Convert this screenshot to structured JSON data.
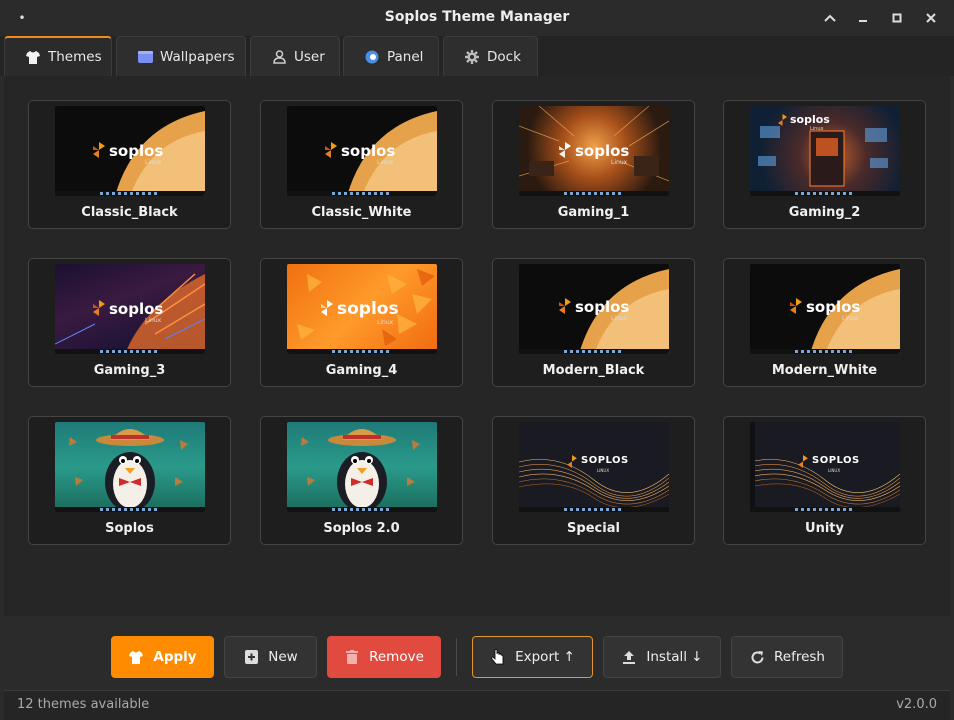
{
  "window": {
    "title": "Soplos Theme Manager",
    "menu_glyph": "•"
  },
  "tabs": [
    {
      "label": "Themes",
      "icon": "shirt-icon",
      "active": true
    },
    {
      "label": "Wallpapers",
      "icon": "wallpaper-icon",
      "active": false
    },
    {
      "label": "User",
      "icon": "user-icon",
      "active": false
    },
    {
      "label": "Panel",
      "icon": "panel-icon",
      "active": false
    },
    {
      "label": "Dock",
      "icon": "gear-icon",
      "active": false
    }
  ],
  "themes": [
    {
      "name": "Classic_Black",
      "logo": "soplos",
      "logo_sub": "Linux"
    },
    {
      "name": "Classic_White",
      "logo": "soplos",
      "logo_sub": "Linux"
    },
    {
      "name": "Gaming_1",
      "logo": "soplos",
      "logo_sub": "Linux"
    },
    {
      "name": "Gaming_2",
      "logo": "soplos",
      "logo_sub": "Linux"
    },
    {
      "name": "Gaming_3",
      "logo": "soplos",
      "logo_sub": "Linux"
    },
    {
      "name": "Gaming_4",
      "logo": "soplos",
      "logo_sub": "Linux"
    },
    {
      "name": "Modern_Black",
      "logo": "soplos",
      "logo_sub": "Linux"
    },
    {
      "name": "Modern_White",
      "logo": "soplos",
      "logo_sub": "Linux"
    },
    {
      "name": "Soplos",
      "logo": "",
      "logo_sub": ""
    },
    {
      "name": "Soplos 2.0",
      "logo": "",
      "logo_sub": ""
    },
    {
      "name": "Special",
      "logo": "SOPLOS",
      "logo_sub": "LINUX"
    },
    {
      "name": "Unity",
      "logo": "SOPLOS",
      "logo_sub": "LINUX"
    }
  ],
  "actions": {
    "apply": "Apply",
    "new": "New",
    "remove": "Remove",
    "export": "Export ↑",
    "install": "Install ↓",
    "refresh": "Refresh"
  },
  "status": {
    "count": "12 themes available",
    "version": "v2.0.0"
  },
  "colors": {
    "accent": "#ff8c00",
    "danger": "#e04a3f"
  }
}
